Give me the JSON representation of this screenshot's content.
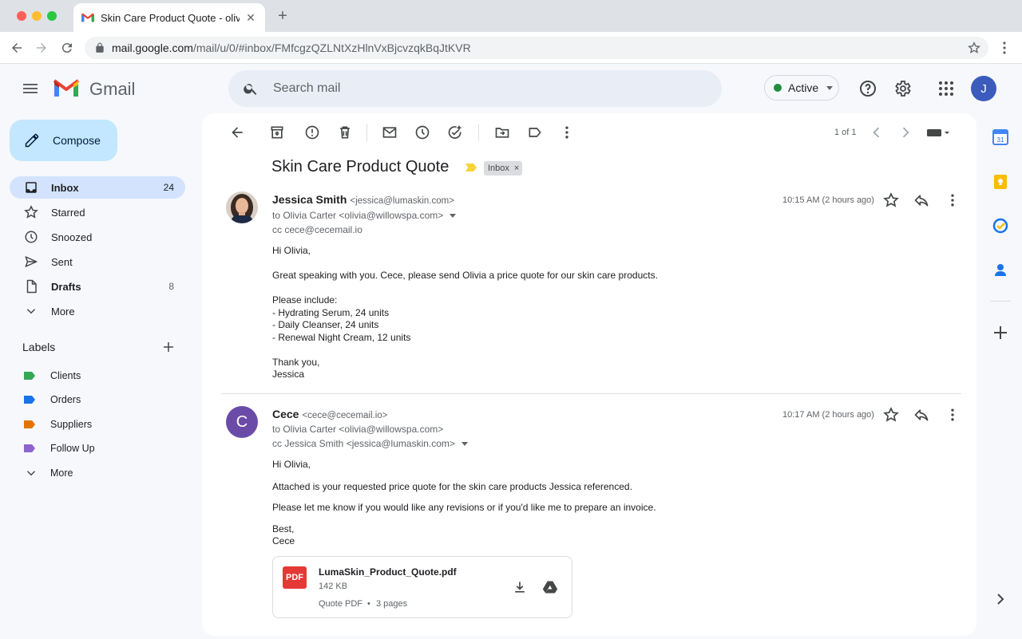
{
  "browser": {
    "tab_title": "Skin Care Product Quote - olivia@",
    "url_host": "mail.google.com",
    "url_path": "/mail/u/0/#inbox/FMfcgzQZLNtXzHlnVxBjcvzqkBqJtKVR"
  },
  "header": {
    "app_name": "Gmail",
    "search_placeholder": "Search mail",
    "status": "Active",
    "status_color": "#1e8e3e",
    "avatar_initial": "J"
  },
  "sidebar": {
    "compose_label": "Compose",
    "items": [
      {
        "label": "Inbox",
        "count": "24",
        "icon": "inbox-icon"
      },
      {
        "label": "Starred",
        "count": "",
        "icon": "star-icon"
      },
      {
        "label": "Snoozed",
        "count": "",
        "icon": "clock-icon"
      },
      {
        "label": "Sent",
        "count": "",
        "icon": "send-icon"
      },
      {
        "label": "Drafts",
        "count": "8",
        "icon": "draft-icon"
      },
      {
        "label": "More",
        "count": "",
        "icon": "chevron-down-icon"
      }
    ],
    "labels_heading": "Labels",
    "labels": [
      {
        "name": "Clients",
        "color": "#34a853"
      },
      {
        "name": "Orders",
        "color": "#1a73e8"
      },
      {
        "name": "Suppliers",
        "color": "#e37400"
      },
      {
        "name": "Follow Up",
        "color": "#8e63ce"
      }
    ],
    "labels_more": "More"
  },
  "thread": {
    "pager": "1 of 1",
    "subject": "Skin Care Product Quote",
    "chip": "Inbox",
    "messages": [
      {
        "sender": "Jessica Smith",
        "email": "<jessica@lumaskin.com>",
        "to": "to Olivia Carter <olivia@willowspa.com>",
        "cc": "cc cece@cecemail.io",
        "time": "10:15 AM (2 hours ago)",
        "body": [
          "Hi Olivia,",
          "Great speaking with you. Cece, please send Olivia a price quote for our skin care products.",
          "Please include:",
          "- Hydrating Serum, 24 units",
          "- Daily Cleanser, 24 units",
          "- Renewal Night Cream, 12 units",
          "Thank you,",
          "Jessica"
        ]
      },
      {
        "sender": "Cece",
        "avatar_initial": "C",
        "email": "<cece@cecemail.io>",
        "to": "to Olivia Carter <olivia@willowspa.com>",
        "cc": "cc Jessica Smith <jessica@lumaskin.com>",
        "time": "10:17 AM (2 hours ago)",
        "body": [
          "Hi Olivia,",
          "Attached is your requested price quote for the skin care products Jessica referenced.",
          "Please let me know if you would like any revisions or if you'd like me to prepare an invoice.",
          "Best,",
          "Cece"
        ],
        "attachment": {
          "badge": "PDF",
          "name": "LumaSkin_Product_Quote.pdf",
          "size": "142 KB",
          "type": "Quote PDF",
          "separator": "•",
          "pages": "3 pages"
        }
      }
    ]
  },
  "side_rail": {
    "calendar_day": "31"
  }
}
